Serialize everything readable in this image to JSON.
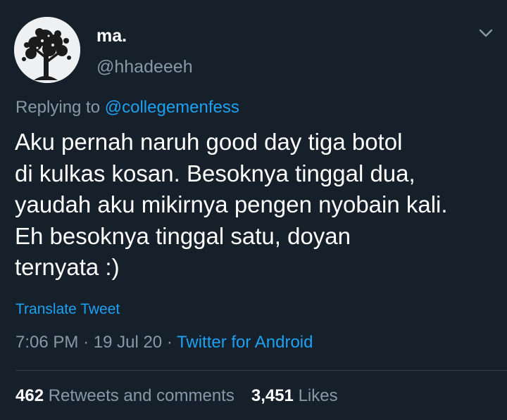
{
  "tweet": {
    "author": {
      "display_name": "ma.",
      "handle": "@hhadeeeh",
      "avatar_icon": "avatar-tree-silhouette"
    },
    "menu_icon": "chevron-down-icon",
    "replying_prefix": "Replying to",
    "replying_to": "@collegemenfess",
    "text_lines": [
      "Aku pernah naruh good day tiga botol",
      "di kulkas kosan. Besoknya tinggal dua,",
      "yaudah aku mikirnya pengen nyobain kali.",
      "Eh besoknya tinggal satu, doyan",
      "ternyata :)"
    ],
    "translate_label": "Translate Tweet",
    "time": "7:06 PM",
    "separator": "·",
    "date": "19 Jul 20",
    "source": "Twitter for Android",
    "stats": {
      "retweets_count": "462",
      "retweets_label": "Retweets and comments",
      "likes_count": "3,451",
      "likes_label": "Likes"
    }
  },
  "colors": {
    "background": "#15202b",
    "text_primary": "#ffffff",
    "text_secondary": "#8899a6",
    "accent": "#1da1f2",
    "divider": "#38444d"
  }
}
